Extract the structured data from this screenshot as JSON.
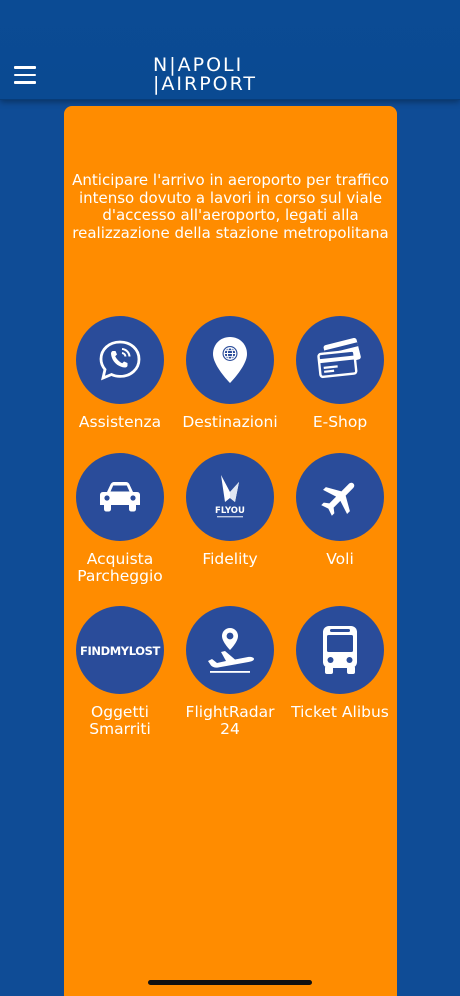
{
  "header": {
    "logo_line1": "N|APOLI",
    "logo_line2": "|AIRPORT"
  },
  "notice": "Anticipare l'arrivo in aeroporto per traffico intenso dovuto a lavori in corso sul viale d'accesso all'aeroporto, legati alla realizzazione della stazione metropolitana",
  "tiles": [
    {
      "label": "Assistenza",
      "icon": "phone-chat-icon"
    },
    {
      "label": "Destinazioni",
      "icon": "location-pin-globe-icon"
    },
    {
      "label": "E-Shop",
      "icon": "credit-cards-icon"
    },
    {
      "label": "Acquista Parcheggio",
      "icon": "car-icon"
    },
    {
      "label": "Fidelity",
      "icon": "flyou-logo-icon",
      "logo_text": "FLYOU"
    },
    {
      "label": "Voli",
      "icon": "airplane-icon"
    },
    {
      "label": "Oggetti Smarriti",
      "icon": "findmylost-logo-icon",
      "logo_text": "FINDMYLOST"
    },
    {
      "label": "FlightRadar 24",
      "icon": "plane-location-icon"
    },
    {
      "label": "Ticket Alibus",
      "icon": "bus-icon"
    }
  ],
  "colors": {
    "background": "#0f4c96",
    "panel": "#ff8c00",
    "tile_circle": "#2a4c9a",
    "text": "#ffffff"
  }
}
